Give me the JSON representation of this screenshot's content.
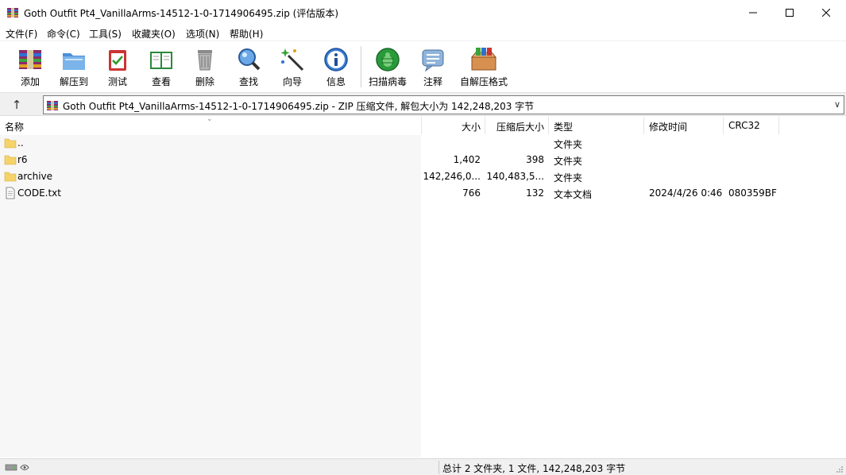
{
  "window": {
    "title": "Goth Outfit Pt4_VanillaArms-14512-1-0-1714906495.zip (评估版本)"
  },
  "menu": [
    "文件(F)",
    "命令(C)",
    "工具(S)",
    "收藏夹(O)",
    "选项(N)",
    "帮助(H)"
  ],
  "toolbar": {
    "add": "添加",
    "extract": "解压到",
    "test": "测试",
    "view": "查看",
    "delete": "删除",
    "find": "查找",
    "wizard": "向导",
    "info": "信息",
    "virus_scan": "扫描病毒",
    "comment": "注释",
    "sfx": "自解压格式"
  },
  "address": {
    "path": "Goth Outfit Pt4_VanillaArms-14512-1-0-1714906495.zip - ZIP 压缩文件, 解包大小为 142,248,203 字节"
  },
  "columns": {
    "name": "名称",
    "size": "大小",
    "packed": "压缩后大小",
    "type": "类型",
    "modified": "修改时间",
    "crc": "CRC32"
  },
  "files": [
    {
      "name": "..",
      "size": "",
      "packed": "",
      "type": "文件夹",
      "modified": "",
      "crc": "",
      "icon": "folder-icon"
    },
    {
      "name": "r6",
      "size": "1,402",
      "packed": "398",
      "type": "文件夹",
      "modified": "",
      "crc": "",
      "icon": "folder-icon"
    },
    {
      "name": "archive",
      "size": "142,246,0...",
      "packed": "140,483,5...",
      "type": "文件夹",
      "modified": "",
      "crc": "",
      "icon": "folder-icon"
    },
    {
      "name": "CODE.txt",
      "size": "766",
      "packed": "132",
      "type": "文本文档",
      "modified": "2024/4/26 0:46",
      "crc": "080359BF",
      "icon": "text-file-icon"
    }
  ],
  "status": {
    "summary": "总计 2 文件夹, 1 文件, 142,248,203 字节"
  },
  "colors": {
    "folder": "#f5d36b",
    "toolbar_bg": "#ffffff",
    "address_bg": "#f0f0f0",
    "status_bg": "#f0f0f0"
  }
}
